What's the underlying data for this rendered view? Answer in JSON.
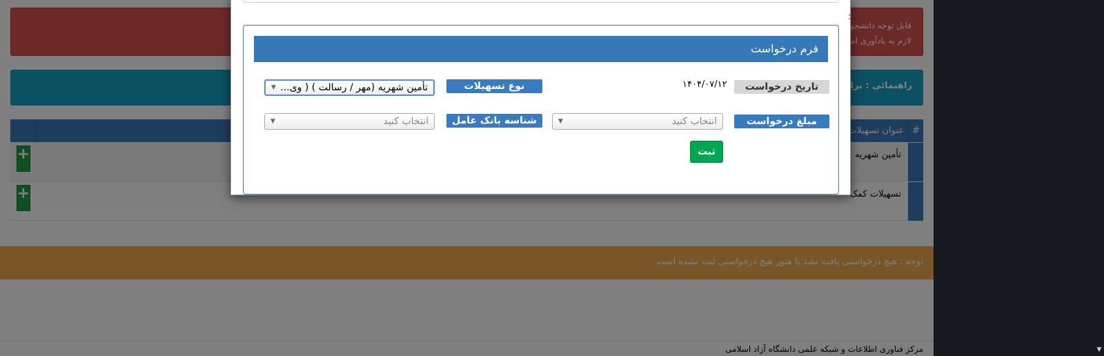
{
  "background": {
    "alert_red_line1": "قابل توجه دانشجو",
    "alert_red_line2": "لازم به یادآوری اس",
    "alert_cyan": "راهنمائی : برای",
    "table": {
      "col_hash": "#",
      "col_title": "عنوان تسهیلات",
      "rows": [
        {
          "title": "تأمین شهریه"
        },
        {
          "title": "تسهیلات کمک"
        }
      ]
    },
    "alert_orange": "توجه : هیچ درخواستی یافت نشد یا هنوز هیچ درخواستی ثبت نشده است",
    "footer": "مرکز فناوری اطلاعات و شبکه علمی دانشگاه آزاد اسلامی"
  },
  "modal": {
    "colon": ":",
    "form_title": "فرم درخواست",
    "fields": {
      "request_date_label": "تاریخ درخواست",
      "request_date_value": "۱۴۰۴/۰۷/۱۲",
      "facility_type_label": "نوع تسهیلات",
      "facility_type_value": "تأمین شهریه (مهر / رسالت ) ( وی...",
      "amount_label": "مبلغ درخواست",
      "amount_placeholder": "انتخاب کنید",
      "bank_id_label": "شناسه بانک عامل",
      "bank_id_placeholder": "انتخاب کنید"
    },
    "submit_label": "ثبت"
  },
  "icons": {
    "plus": "plus-icon",
    "dropdown": "chevron-down-icon"
  },
  "colors": {
    "header_blue": "#3779b8",
    "label_blue": "#3a7bbf",
    "submit_green": "#00a651",
    "alert_red": "#d9534f",
    "alert_cyan": "#17a2c4",
    "alert_orange": "#f0ad4e"
  }
}
